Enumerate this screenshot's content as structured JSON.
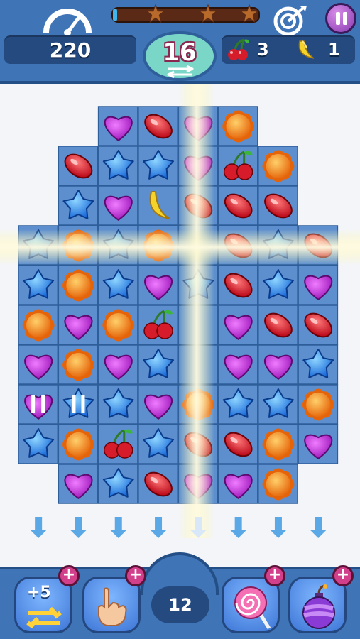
{
  "hud": {
    "score": "220",
    "moves_left": "16",
    "goals": [
      {
        "icon": "cherry-icon",
        "count": "3"
      },
      {
        "icon": "banana-icon",
        "count": "1"
      }
    ],
    "progress": 0.03,
    "stars": 3
  },
  "booster_count": "12",
  "boosters": [
    {
      "name": "extra-moves-booster",
      "label": "+5"
    },
    {
      "name": "hand-booster",
      "label": ""
    },
    {
      "name": "lollipop-booster",
      "label": ""
    },
    {
      "name": "bomb-booster",
      "label": ""
    }
  ],
  "board": {
    "rows": [
      [
        "_",
        "_",
        "heart",
        "jelly",
        "heart",
        "orange",
        "_",
        "_"
      ],
      [
        "_",
        "jelly",
        "star",
        "star",
        "heart",
        "cherry",
        "orange",
        "_"
      ],
      [
        "_",
        "star",
        "heart",
        "banana",
        "jelly",
        "jelly",
        "jelly",
        "_"
      ],
      [
        "star",
        "orange",
        "star",
        "orange",
        "_",
        "jelly",
        "star",
        "jelly"
      ],
      [
        "star",
        "orange",
        "star",
        "heart",
        "star",
        "jelly",
        "star",
        "heart"
      ],
      [
        "orange",
        "heart",
        "orange",
        "cherry",
        "_",
        "heart",
        "jelly",
        "jelly"
      ],
      [
        "heart",
        "orange",
        "heart",
        "star",
        "_",
        "heart",
        "heart",
        "star"
      ],
      [
        "striped-heart",
        "striped-star",
        "star",
        "heart",
        "orange",
        "star",
        "star",
        "orange"
      ],
      [
        "star",
        "orange",
        "cherry",
        "star",
        "jelly",
        "jelly",
        "orange",
        "heart"
      ],
      [
        "_",
        "heart",
        "star",
        "jelly",
        "heart",
        "heart",
        "orange",
        "_"
      ]
    ]
  },
  "colors": {
    "blue": "#3f74b6",
    "panel": "#244a80",
    "heart": "#c23fd8",
    "star": "#2e8af0",
    "orange": "#f3811b",
    "jelly": "#e11a28",
    "cell": "#5d8fcf"
  }
}
